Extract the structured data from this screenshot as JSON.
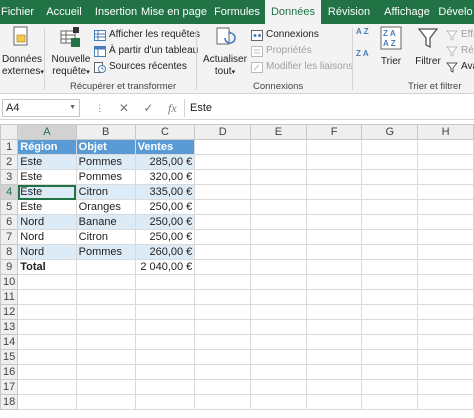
{
  "tabs": [
    "Fichier",
    "Accueil",
    "Insertion",
    "Mise en page",
    "Formules",
    "Données",
    "Révision",
    "Affichage",
    "Dévelo"
  ],
  "active_tab": "Données",
  "ribbon": {
    "donnees_externes": {
      "line1": "Données",
      "line2": "externes"
    },
    "nouvelle_requete": {
      "line1": "Nouvelle",
      "line2": "requête"
    },
    "afficher_requetes": "Afficher les requêtes",
    "a_partir_tableau": "À partir d'un tableau",
    "sources_recentes": "Sources récentes",
    "group_recuperer": "Récupérer et transformer",
    "actualiser": {
      "line1": "Actualiser",
      "line2": "tout"
    },
    "connexions": "Connexions",
    "proprietes": "Propriétés",
    "modifier_liaisons": "Modifier les liaisons",
    "group_connexions": "Connexions",
    "az_top": "A Z",
    "za_top": "Z A",
    "trier": "Trier",
    "filtrer": "Filtrer",
    "effacer": "Effa",
    "reappliquer": "Réa",
    "avance": "Ava",
    "group_trier": "Trier et filtrer"
  },
  "formula_bar": {
    "name_box": "A4",
    "cancel": "✕",
    "enter": "✓",
    "fx": "fx",
    "content": "Este"
  },
  "columns": [
    "A",
    "B",
    "C",
    "D",
    "E",
    "F",
    "G",
    "H"
  ],
  "rows": [
    [
      "Région",
      "Objet",
      "Ventes"
    ],
    [
      "Este",
      "Pommes",
      "285,00 €"
    ],
    [
      "Este",
      "Pommes",
      "320,00 €"
    ],
    [
      "Este",
      "Citron",
      "335,00 €"
    ],
    [
      "Este",
      "Oranges",
      "250,00 €"
    ],
    [
      "Nord",
      "Banane",
      "250,00 €"
    ],
    [
      "Nord",
      "Citron",
      "250,00 €"
    ],
    [
      "Nord",
      "Pommes",
      "260,00 €"
    ],
    [
      "Total",
      "",
      "2 040,00 €"
    ]
  ],
  "row_numbers": [
    "1",
    "2",
    "3",
    "4",
    "5",
    "6",
    "7",
    "8",
    "9",
    "10",
    "11",
    "12",
    "13",
    "14",
    "15",
    "16",
    "17",
    "18"
  ],
  "colors": {
    "excel_green": "#217346",
    "table_header": "#5b9bd5",
    "table_band": "#ddebf7"
  }
}
